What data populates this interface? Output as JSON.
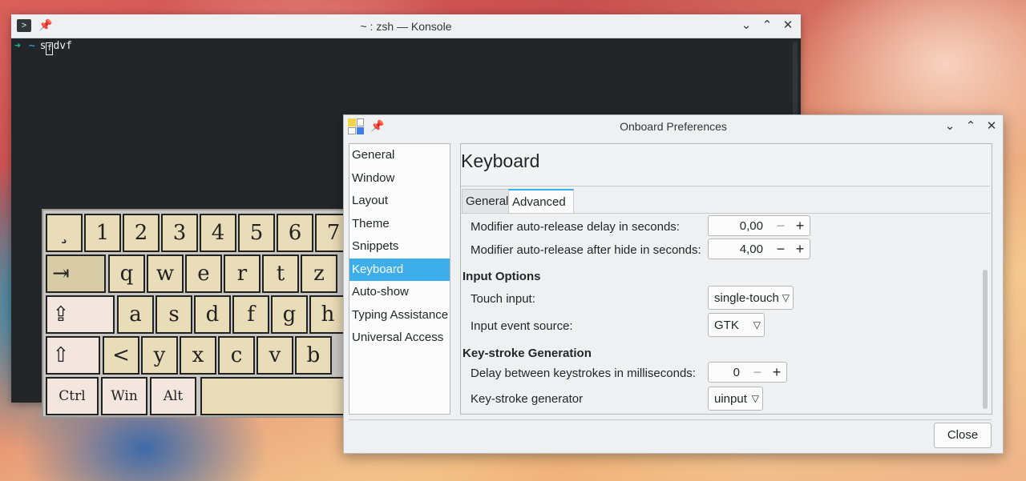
{
  "konsole": {
    "title": "~ : zsh — Konsole",
    "prompt_arrow": "➜",
    "prompt_dir": "~",
    "cmd_before": "s",
    "cmd_cursor": "f",
    "cmd_after": "dvf"
  },
  "keyboard": {
    "row1": [
      "¸",
      "1",
      "2",
      "3",
      "4",
      "5",
      "6",
      "7"
    ],
    "row2": [
      "⇥",
      "q",
      "w",
      "e",
      "r",
      "t",
      "z"
    ],
    "row3": [
      "⇪",
      "a",
      "s",
      "d",
      "f",
      "g",
      "h"
    ],
    "row4": [
      "⇧",
      "<",
      "y",
      "x",
      "c",
      "v",
      "b"
    ],
    "row5": [
      "Ctrl",
      "Win",
      "Alt",
      ""
    ]
  },
  "prefs": {
    "title": "Onboard Preferences",
    "sidebar": [
      "General",
      "Window",
      "Layout",
      "Theme",
      "Snippets",
      "Keyboard",
      "Auto-show",
      "Typing Assistance",
      "Universal Access"
    ],
    "active_index": 5,
    "heading": "Keyboard",
    "tabs": {
      "general": "General",
      "advanced": "Advanced"
    },
    "rows": {
      "mod_delay_label": "Modifier auto-release delay in seconds:",
      "mod_delay_value": "0,00",
      "mod_hide_label": "Modifier auto-release after hide in seconds:",
      "mod_hide_value": "4,00",
      "input_options": "Input Options",
      "touch_label": "Touch input:",
      "touch_value": "single-touch",
      "event_label": "Input event source:",
      "event_value": "GTK",
      "keystroke_section": "Key-stroke Generation",
      "delay_label": "Delay between keystrokes in milliseconds:",
      "delay_value": "0",
      "generator_label": "Key-stroke generator",
      "generator_value": "uinput"
    },
    "close": "Close"
  }
}
